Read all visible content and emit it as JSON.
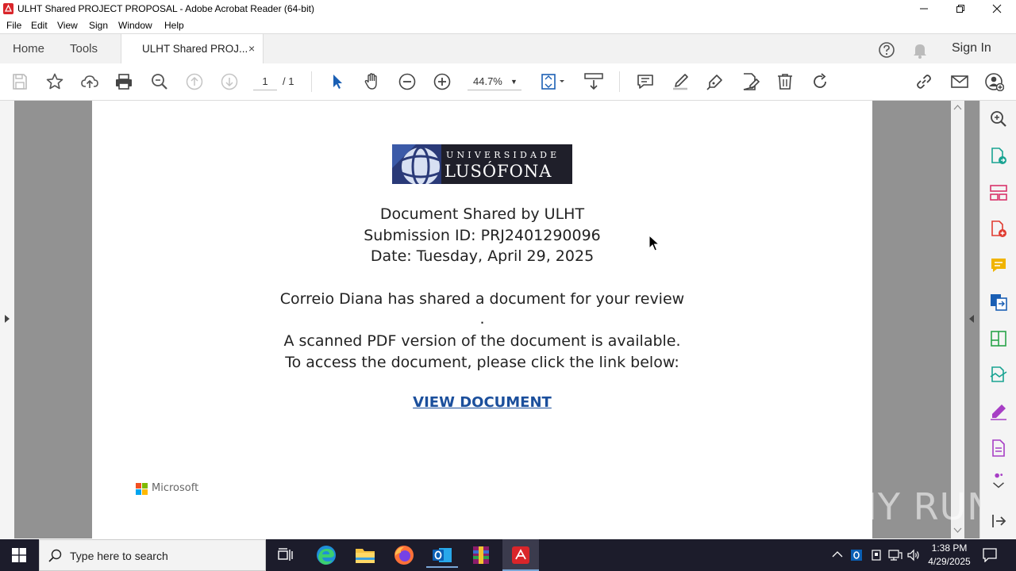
{
  "window": {
    "title": "ULHT Shared PROJECT PROPOSAL - Adobe Acrobat Reader (64-bit)",
    "controls": [
      "minimize",
      "restore",
      "close"
    ]
  },
  "menu": [
    "File",
    "Edit",
    "View",
    "Sign",
    "Window",
    "Help"
  ],
  "tabs": {
    "home": "Home",
    "tools": "Tools",
    "document": "ULHT Shared PROJ...",
    "close": "×",
    "sign_in": "Sign In"
  },
  "toolbar": {
    "page_current": "1",
    "page_total": "/ 1",
    "zoom": "44.7%",
    "zoom_caret": "▼"
  },
  "document": {
    "logo_top": "UNIVERSIDADE",
    "logo_bottom": "LUSÓFONA",
    "line1": "Document Shared by ULHT",
    "line2": "Submission ID: PRJ2401290096",
    "line3": "Date: Tuesday, April 29, 2025",
    "line4": "Correio Diana has shared a document for your review",
    "line5": ".",
    "line6": "A scanned PDF version of the document is available.",
    "line7": "To access the document, please click the link below:",
    "link": "VIEW DOCUMENT",
    "footer_brand": "Microsoft"
  },
  "watermark": "ANY RUN",
  "taskbar": {
    "search_placeholder": "Type here to search",
    "time": "1:38 PM",
    "date": "4/29/2025"
  },
  "colors": {
    "link": "#1b4f9c",
    "acrobat_red": "#d9252a",
    "taskbar": "#1c1c2b",
    "viewer_bg": "#929292"
  }
}
